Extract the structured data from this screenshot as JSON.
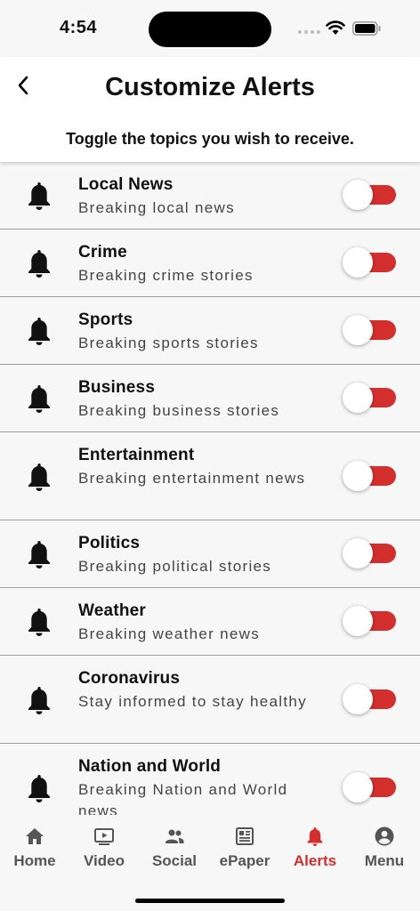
{
  "status_bar": {
    "time": "4:54"
  },
  "header": {
    "title": "Customize Alerts",
    "subtitle": "Toggle the topics you wish to receive."
  },
  "colors": {
    "accent": "#d32f2f",
    "text": "#111111",
    "muted": "#555555"
  },
  "alerts": [
    {
      "title": "Local News",
      "description": "Breaking local news",
      "enabled": false
    },
    {
      "title": "Crime",
      "description": "Breaking crime stories",
      "enabled": false
    },
    {
      "title": "Sports",
      "description": "Breaking sports stories",
      "enabled": false
    },
    {
      "title": "Business",
      "description": "Breaking business stories",
      "enabled": false
    },
    {
      "title": "Entertainment",
      "description": "Breaking entertainment news",
      "enabled": false
    },
    {
      "title": "Politics",
      "description": "Breaking political stories",
      "enabled": false
    },
    {
      "title": "Weather",
      "description": "Breaking weather news",
      "enabled": false
    },
    {
      "title": "Coronavirus",
      "description": "Stay informed to stay healthy",
      "enabled": false
    },
    {
      "title": "Nation and World",
      "description": "Breaking Nation and World news",
      "enabled": false
    }
  ],
  "tabs": [
    {
      "label": "Home",
      "icon": "home-icon",
      "active": false
    },
    {
      "label": "Video",
      "icon": "video-icon",
      "active": false
    },
    {
      "label": "Social",
      "icon": "people-icon",
      "active": false
    },
    {
      "label": "ePaper",
      "icon": "newspaper-icon",
      "active": false
    },
    {
      "label": "Alerts",
      "icon": "bell-icon",
      "active": true
    },
    {
      "label": "Menu",
      "icon": "account-circle-icon",
      "active": false
    }
  ]
}
